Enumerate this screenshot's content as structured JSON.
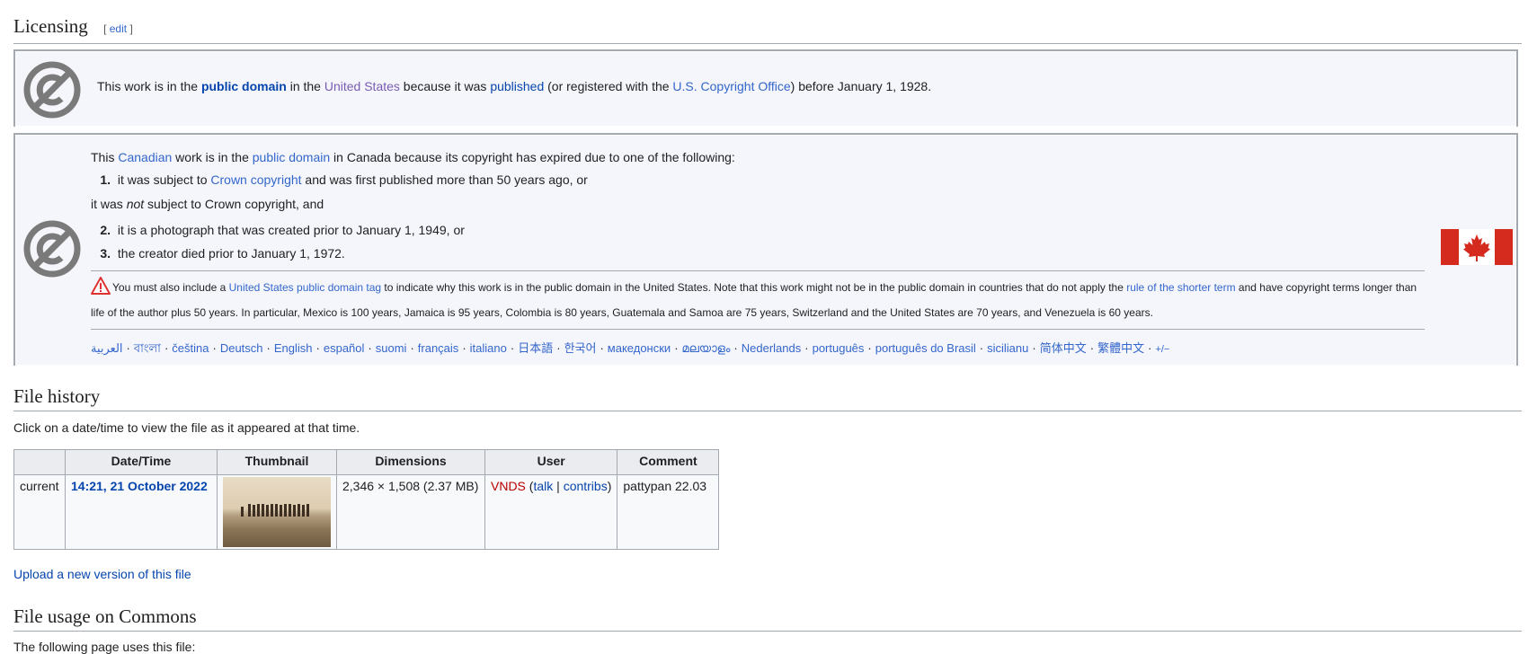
{
  "licensing": {
    "heading": "Licensing",
    "edit_open": "[",
    "edit_label": "edit",
    "edit_close": "]"
  },
  "us_pd": {
    "t1": "This work is in the ",
    "l_public_domain": "public domain",
    "t2": " in the ",
    "l_united_states": "United States",
    "t3": " because it was ",
    "l_published": "published",
    "t4": " (or registered with the ",
    "l_copyright_office": "U.S. Copyright Office",
    "t5": ") before January 1, 1928."
  },
  "ca_pd": {
    "t1": "This ",
    "l_canadian": "Canadian",
    "t2": " work is in the ",
    "l_public_domain": "public domain",
    "t3": " in Canada because its copyright has expired due to one of the following:",
    "item1_num": "1.",
    "item1_t1": " it was subject to ",
    "item1_link": "Crown copyright",
    "item1_t2": " and was first published more than 50 years ago, or",
    "mid_t1": "it was ",
    "mid_em": "not",
    "mid_t2": " subject to Crown copyright, and",
    "item2_num": "2.",
    "item2_text": " it is a photograph that was created prior to January 1, 1949, or",
    "item3_num": "3.",
    "item3_text": " the creator died prior to January 1, 1972.",
    "warn_t1": "You must also include a ",
    "warn_link1": "United States public domain tag",
    "warn_t2": " to indicate why this work is in the public domain in the United States. Note that this work might not be in the public domain in countries that do not apply the ",
    "warn_link2": "rule of the shorter term",
    "warn_t3": " and have copyright terms longer than life of the author plus 50 years. In particular, Mexico is 100 years, Jamaica is 95 years, Colombia is 80 years, Guatemala and Samoa are 75 years, Switzerland and the United States are 70 years, and Venezuela is 60 years.",
    "languages": [
      "العربية",
      "বাংলা",
      "čeština",
      "Deutsch",
      "English",
      "español",
      "suomi",
      "français",
      "italiano",
      "日本語",
      "한국어",
      "македонски",
      "മലയാളം",
      "Nederlands",
      "português",
      "português do Brasil",
      "sicilianu",
      "简体中文",
      "繁體中文",
      "+/−"
    ]
  },
  "file_history": {
    "heading": "File history",
    "intro": "Click on a date/time to view the file as it appeared at that time.",
    "columns": [
      "",
      "Date/Time",
      "Thumbnail",
      "Dimensions",
      "User",
      "Comment"
    ],
    "row": {
      "status": "current",
      "datetime": "14:21, 21 October 2022",
      "dimensions": "2,346 × 1,508 (2.37 MB)",
      "user": "VNDS",
      "paren_open": " (",
      "talk": "talk",
      "pipe": " | ",
      "contribs": "contribs",
      "paren_close": ")",
      "comment": "pattypan 22.03"
    },
    "upload_link": "Upload a new version of this file"
  },
  "file_usage": {
    "heading": "File usage on Commons",
    "intro": "The following page uses this file:"
  },
  "colors": {
    "link": "#3366cc",
    "redlink": "#ba0000",
    "box_bg": "#f5f6fb",
    "flag_red": "#d52b1e"
  }
}
